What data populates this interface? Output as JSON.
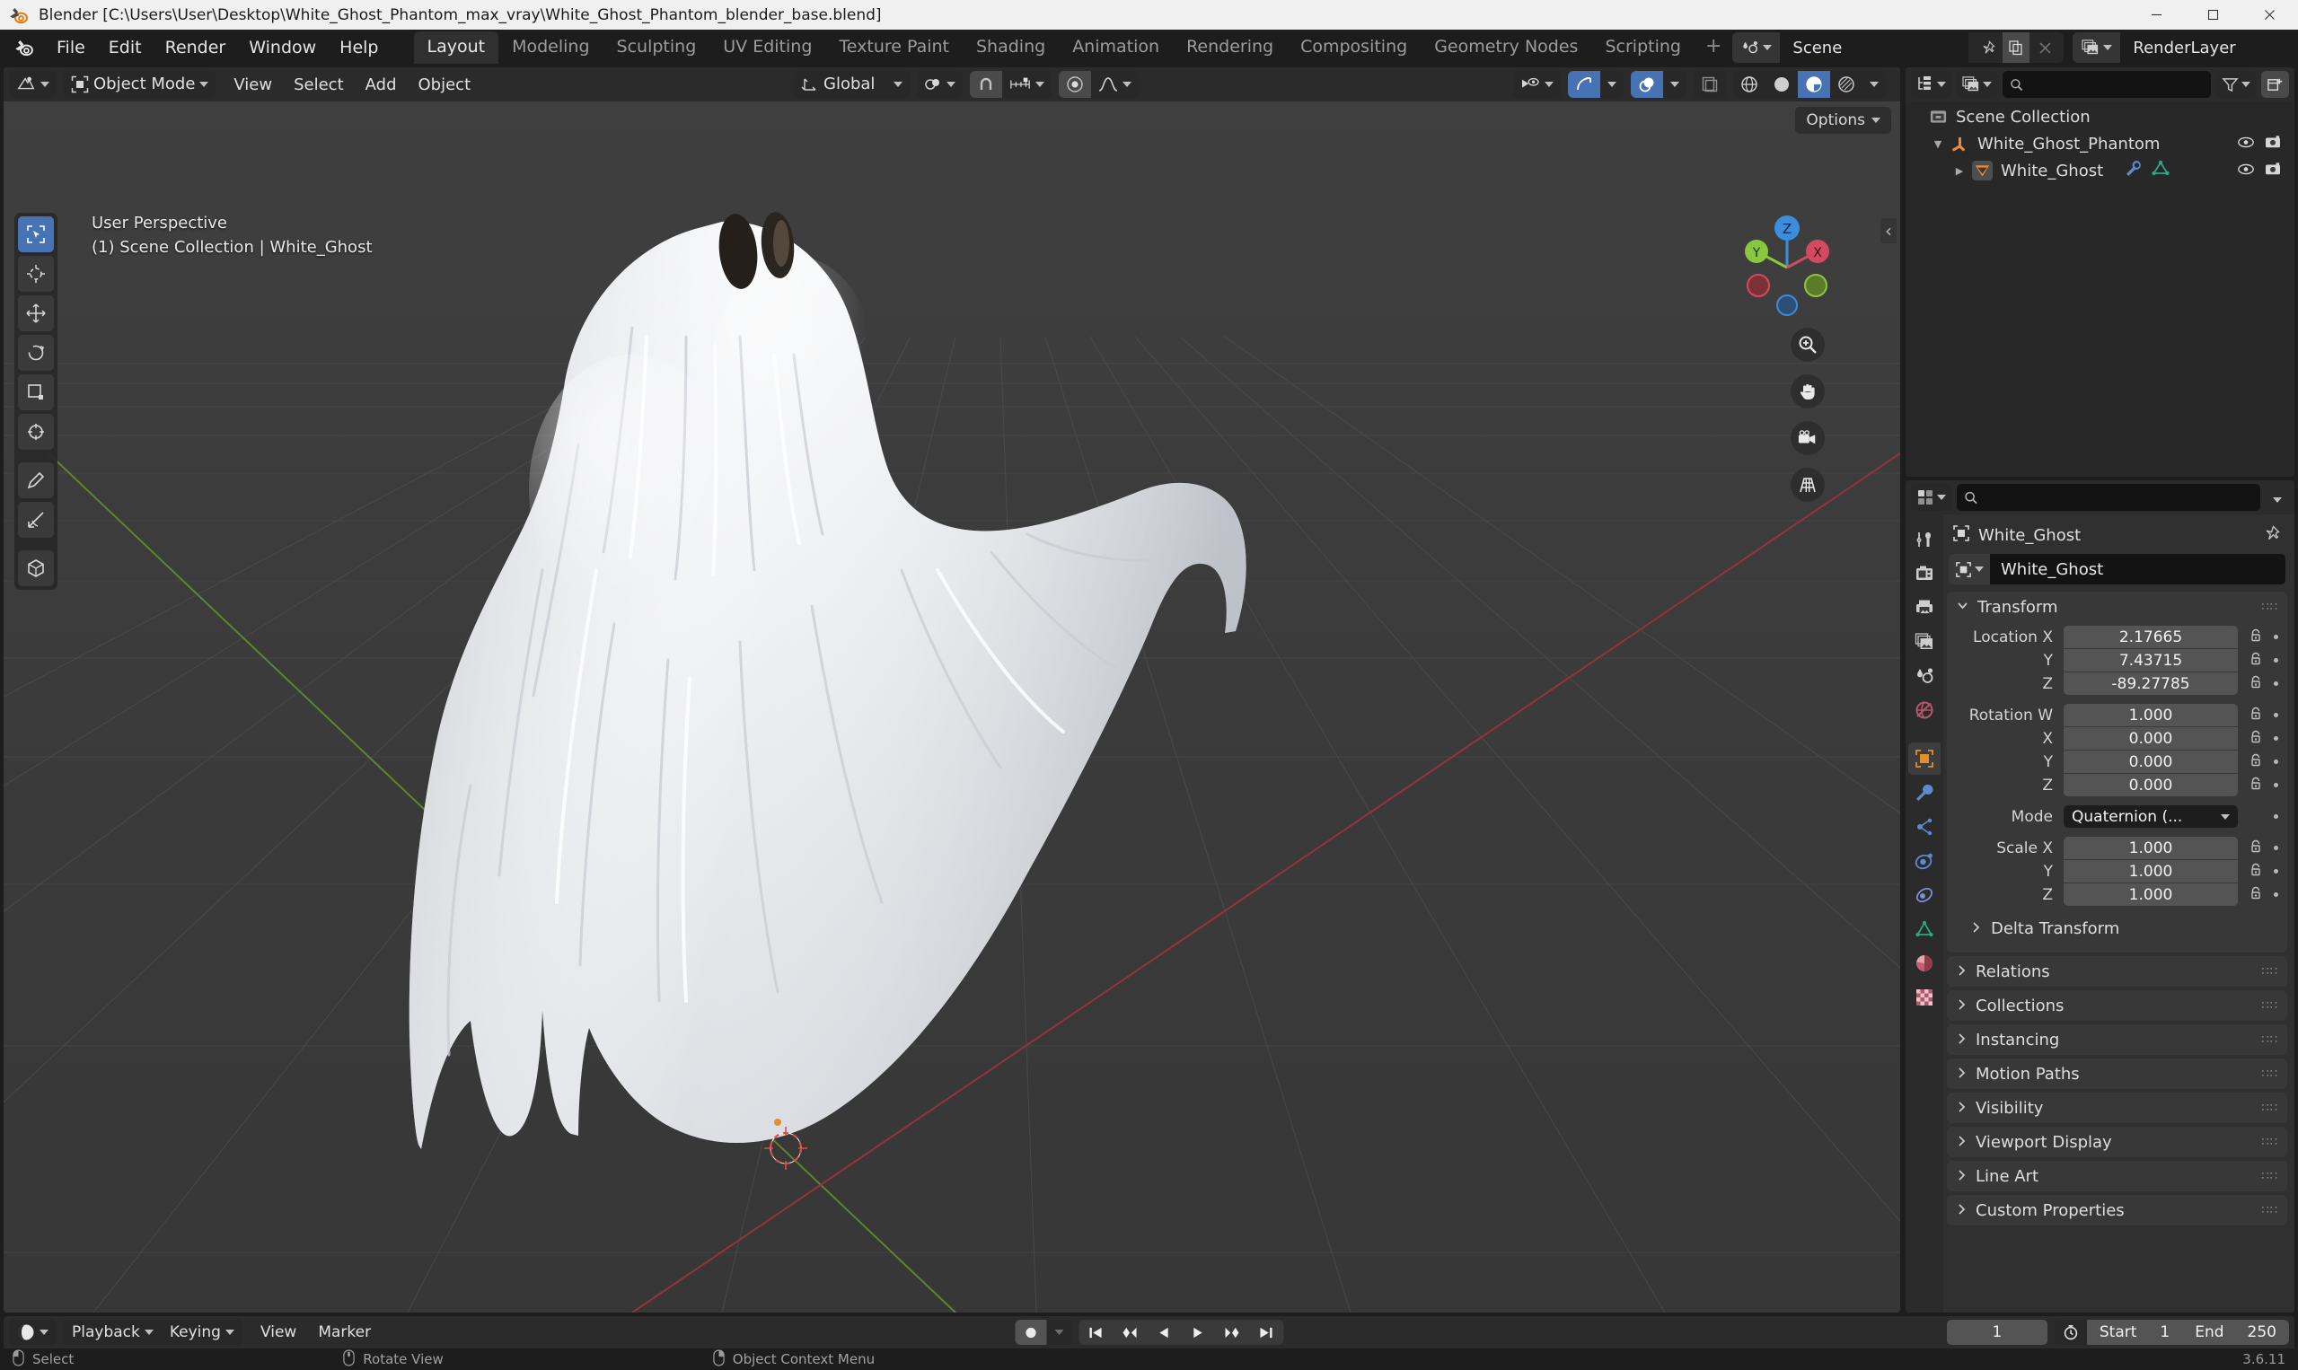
{
  "window": {
    "title": "Blender [C:\\Users\\User\\Desktop\\White_Ghost_Phantom_max_vray\\White_Ghost_Phantom_blender_base.blend]",
    "minimize_label": "Minimize",
    "maximize_label": "Maximize",
    "close_label": "Close"
  },
  "topbar": {
    "menus": [
      "File",
      "Edit",
      "Render",
      "Window",
      "Help"
    ],
    "workspaces": [
      {
        "label": "Layout",
        "active": true
      },
      {
        "label": "Modeling",
        "active": false
      },
      {
        "label": "Sculpting",
        "active": false
      },
      {
        "label": "UV Editing",
        "active": false
      },
      {
        "label": "Texture Paint",
        "active": false
      },
      {
        "label": "Shading",
        "active": false
      },
      {
        "label": "Animation",
        "active": false
      },
      {
        "label": "Rendering",
        "active": false
      },
      {
        "label": "Compositing",
        "active": false
      },
      {
        "label": "Geometry Nodes",
        "active": false
      },
      {
        "label": "Scripting",
        "active": false
      }
    ],
    "add_workspace_label": "+",
    "scene_name": "Scene",
    "view_layer_name": "RenderLayer"
  },
  "viewport": {
    "mode": "Object Mode",
    "menus": [
      "View",
      "Select",
      "Add",
      "Object"
    ],
    "transform_orientation": "Global",
    "options_label": "Options",
    "overlay_line1": "User Perspective",
    "overlay_line2": "(1) Scene Collection | White_Ghost",
    "gizmo_axes": [
      {
        "label": "Z",
        "color": "#3c8ddb"
      },
      {
        "label": "Y",
        "color": "#8bc63f"
      },
      {
        "label": "X",
        "color": "#d34a5e"
      }
    ],
    "nav_buttons": [
      "zoom-icon",
      "pan-hand-icon",
      "camera-view-icon",
      "ortho-persp-icon"
    ],
    "tools": [
      {
        "name": "tweak-select-box",
        "active": true
      },
      {
        "name": "cursor",
        "active": false
      },
      {
        "name": "move",
        "active": false
      },
      {
        "name": "rotate",
        "active": false
      },
      {
        "name": "scale",
        "active": false
      },
      {
        "name": "transform",
        "active": false
      },
      {
        "name": "annotate",
        "active": false
      },
      {
        "name": "measure",
        "active": false
      },
      {
        "name": "add-cube",
        "active": false
      }
    ]
  },
  "outliner": {
    "search_placeholder": "",
    "search_value": "",
    "rows": [
      {
        "label": "Scene Collection",
        "icon": "collection-icon",
        "indent": 0,
        "disclosure": "",
        "extra_icons": [],
        "visibility": false
      },
      {
        "label": "White_Ghost_Phantom",
        "icon": "empty-axis-icon",
        "indent": 1,
        "disclosure": "down",
        "extra_icons": [],
        "visibility": true
      },
      {
        "label": "White_Ghost",
        "icon": "mesh-object-icon",
        "indent": 2,
        "disclosure": "right",
        "extra_icons": [
          "modifier-wrench-icon",
          "mesh-data-icon"
        ],
        "visibility": true
      }
    ]
  },
  "properties": {
    "breadcrumb": "White_Ghost",
    "object_name": "White_Ghost",
    "tabs": [
      {
        "name": "tool-tab",
        "icon": "wrench-screwdriver-icon",
        "active": false
      },
      {
        "name": "render-tab",
        "icon": "camera-back-icon",
        "active": false
      },
      {
        "name": "output-tab",
        "icon": "printer-icon",
        "active": false
      },
      {
        "name": "view-layer-tab",
        "icon": "images-icon",
        "active": false
      },
      {
        "name": "scene-tab",
        "icon": "cone-sphere-icon",
        "active": false
      },
      {
        "name": "world-tab",
        "icon": "world-globe-icon",
        "active": false
      },
      {
        "name": "object-tab",
        "icon": "object-square-icon",
        "active": true
      },
      {
        "name": "modifier-tab",
        "icon": "wrench-icon",
        "active": false
      },
      {
        "name": "particles-tab",
        "icon": "particles-icon",
        "active": false
      },
      {
        "name": "physics-tab",
        "icon": "physics-orbit-icon",
        "active": false
      },
      {
        "name": "constraints-tab",
        "icon": "constraint-icon",
        "active": false
      },
      {
        "name": "data-tab",
        "icon": "mesh-data-triangle-icon",
        "active": false
      },
      {
        "name": "material-tab",
        "icon": "material-sphere-icon",
        "active": false
      },
      {
        "name": "texture-tab",
        "icon": "checker-texture-icon",
        "active": false
      }
    ],
    "transform": {
      "title": "Transform",
      "fields": [
        {
          "label": "Location X",
          "value": "2.17665",
          "type": "number"
        },
        {
          "label": "Y",
          "value": "7.43715",
          "type": "number"
        },
        {
          "label": "Z",
          "value": "-89.27785",
          "type": "number"
        },
        {
          "label": "Rotation W",
          "value": "1.000",
          "type": "number"
        },
        {
          "label": "X",
          "value": "0.000",
          "type": "number"
        },
        {
          "label": "Y",
          "value": "0.000",
          "type": "number"
        },
        {
          "label": "Z",
          "value": "0.000",
          "type": "number"
        },
        {
          "label": "Mode",
          "value": "Quaternion (...",
          "type": "dropdown"
        },
        {
          "label": "Scale X",
          "value": "1.000",
          "type": "number"
        },
        {
          "label": "Y",
          "value": "1.000",
          "type": "number"
        },
        {
          "label": "Z",
          "value": "1.000",
          "type": "number"
        }
      ],
      "delta_transform_label": "Delta Transform"
    },
    "panels": [
      "Relations",
      "Collections",
      "Instancing",
      "Motion Paths",
      "Visibility",
      "Viewport Display",
      "Line Art",
      "Custom Properties"
    ]
  },
  "timeline": {
    "menus": [
      "Playback",
      "Keying",
      "View",
      "Marker"
    ],
    "playback_label": "Playback",
    "keying_label": "Keying",
    "current_frame": "1",
    "start_label": "Start",
    "start_value": "1",
    "end_label": "End",
    "end_value": "250",
    "transport": [
      "jump-to-start-icon",
      "jump-to-prev-keyframe-icon",
      "play-reverse-icon",
      "play-icon",
      "jump-to-next-keyframe-icon",
      "jump-to-end-icon"
    ]
  },
  "statusbar": {
    "items": [
      {
        "icon": "mouse-left-icon",
        "label": "Select"
      },
      {
        "icon": "mouse-middle-icon",
        "label": "Rotate View"
      },
      {
        "icon": "mouse-right-icon",
        "label": "Object Context Menu"
      }
    ],
    "version": "3.6.11"
  },
  "colors": {
    "accent_blue": "#4772b3",
    "titlebar_bg": "#f0f0f0",
    "editor_bg": "#303030",
    "header_bg": "#2b2b2b",
    "viewport_bg": "#3c3c3c",
    "axis_x": "#c1384a",
    "axis_y": "#6a9b2e"
  }
}
